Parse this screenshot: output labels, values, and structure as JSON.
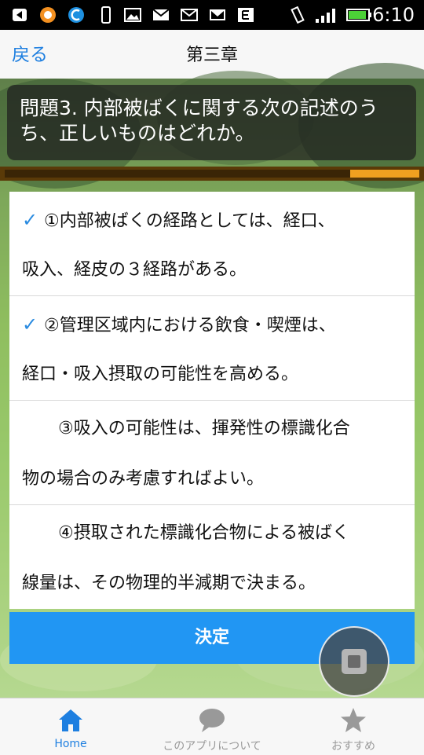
{
  "status_bar": {
    "time": "6:10"
  },
  "nav": {
    "back_label": "戻る",
    "title": "第三章"
  },
  "question": {
    "text": "問題3. 内部被ばくに関する次の記述のうち、正しいものはどれか。"
  },
  "progress": {
    "fraction": 0.167
  },
  "options": [
    {
      "checked": true,
      "line1": "①内部被ばくの経路としては、経口、",
      "line2": "吸入、経皮の３経路がある。"
    },
    {
      "checked": true,
      "line1": "②管理区域内における飲食・喫煙は、",
      "line2": "経口・吸入摂取の可能性を高める。"
    },
    {
      "checked": false,
      "line1": "③吸入の可能性は、揮発性の標識化合",
      "line2": "物の場合のみ考慮すればよい。"
    },
    {
      "checked": false,
      "line1": "④摂取された標識化合物による被ばく",
      "line2": "線量は、その物理的半減期で決まる。"
    }
  ],
  "decide_label": "決定",
  "tabs": [
    {
      "label": "Home",
      "icon": "home-icon",
      "active": true
    },
    {
      "label": "このアプリについて",
      "icon": "chat-bubble-icon",
      "active": false
    },
    {
      "label": "おすすめ",
      "icon": "star-icon",
      "active": false
    }
  ],
  "colors": {
    "accent": "#2196f3",
    "check": "#2a8be0",
    "progress": "#f0a020"
  }
}
